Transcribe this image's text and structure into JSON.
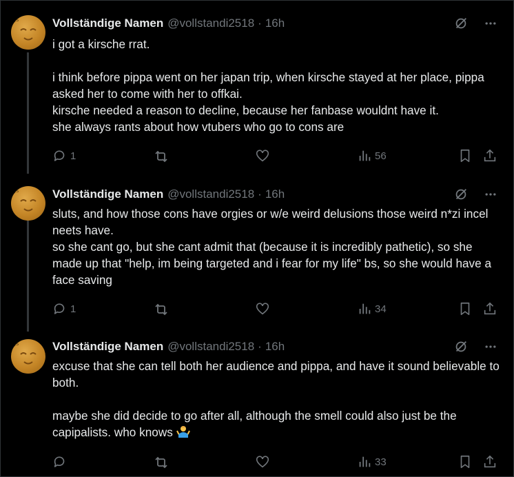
{
  "tweets": [
    {
      "name": "Vollständige Namen",
      "handle": "@vollstandi2518",
      "time": "16h",
      "text": "i got a kirsche rrat.\n\ni think before pippa went on her japan trip, when kirsche stayed at her place, pippa asked her to come with her to offkai.\nkirsche needed a reason to decline, because her fanbase wouldnt have it.\nshe always rants about how vtubers who go to cons are",
      "replies": "1",
      "views": "56"
    },
    {
      "name": "Vollständige Namen",
      "handle": "@vollstandi2518",
      "time": "16h",
      "text": "sluts, and how those cons have orgies or w/e weird delusions those weird n*zi incel neets have.\nso she cant go, but she cant admit that (because it is incredibly pathetic), so she made up that \"help, im being targeted and i fear for my life\" bs, so she would have a face saving",
      "replies": "1",
      "views": "34"
    },
    {
      "name": "Vollständige Namen",
      "handle": "@vollstandi2518",
      "time": "16h",
      "text": "excuse that she can tell both her audience and pippa, and have it sound believable to both.\n\nmaybe she did decide to go after all, although the smell could also just be the capipalists. who knows ",
      "emoji": "person-shrugging",
      "replies": "",
      "views": "33"
    }
  ],
  "icons": {
    "grok": "slashed-circle-icon",
    "more": "more-icon",
    "reply": "reply-icon",
    "repost": "repost-icon",
    "like": "heart-icon",
    "views": "views-icon",
    "bookmark": "bookmark-icon",
    "share": "share-icon"
  },
  "colors": {
    "background": "#000000",
    "text": "#e7e9ea",
    "muted": "#71767b",
    "thread_line": "#333639"
  }
}
